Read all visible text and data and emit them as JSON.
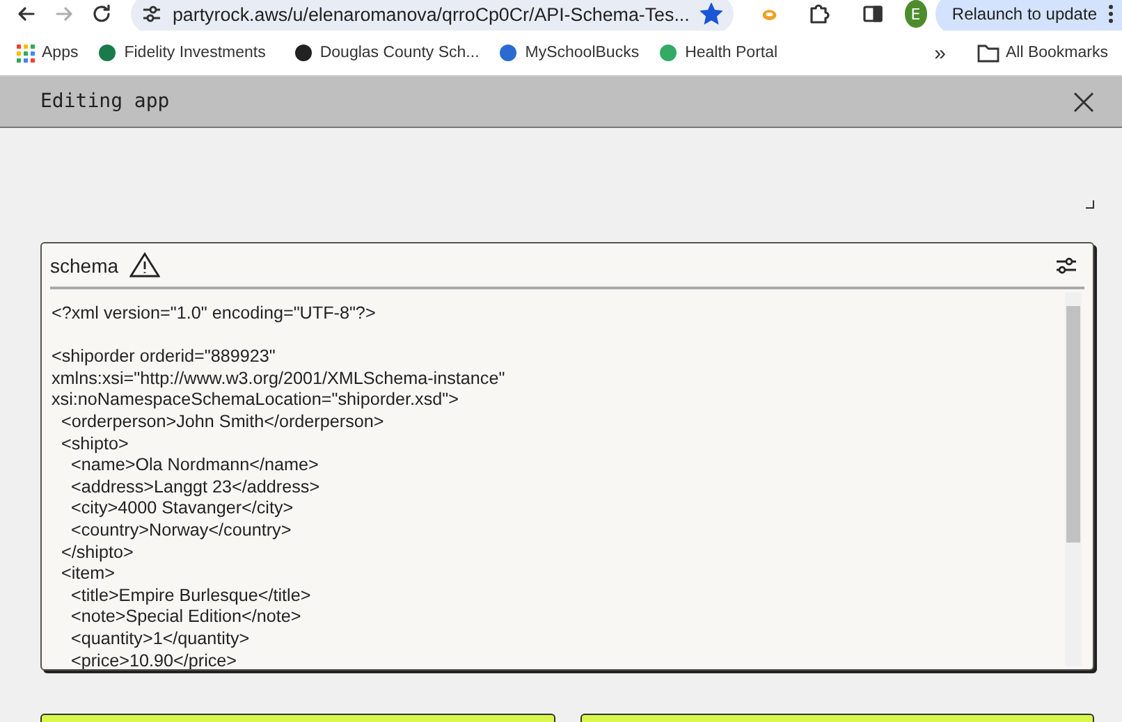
{
  "browser": {
    "url": "partyrock.aws/u/elenaromanova/qrroCp0Cr/API-Schema-Tes...",
    "forward_disabled": true,
    "bookmarked": true,
    "profile_initial": "E",
    "relaunch_label": "Relaunch to update"
  },
  "bookmarks": [
    {
      "label": "Apps"
    },
    {
      "label": "Fidelity Investments"
    },
    {
      "label": "Douglas County Sch..."
    },
    {
      "label": "MySchoolBucks"
    },
    {
      "label": "Health Portal"
    }
  ],
  "bookmarks_overflow": "»",
  "all_bookmarks": "All Bookmarks",
  "dialog": {
    "title": "Editing app"
  },
  "widget": {
    "title": "schema",
    "warning": true,
    "content": "<?xml version=\"1.0\" encoding=\"UTF-8\"?>\n\n<shiporder orderid=\"889923\"\nxmlns:xsi=\"http://www.w3.org/2001/XMLSchema-instance\"\nxsi:noNamespaceSchemaLocation=\"shiporder.xsd\">\n  <orderperson>John Smith</orderperson>\n  <shipto>\n    <name>Ola Nordmann</name>\n    <address>Langgt 23</address>\n    <city>4000 Stavanger</city>\n    <country>Norway</country>\n  </shipto>\n  <item>\n    <title>Empire Burlesque</title>\n    <note>Special Edition</note>\n    <quantity>1</quantity>\n    <price>10.90</price>"
  }
}
